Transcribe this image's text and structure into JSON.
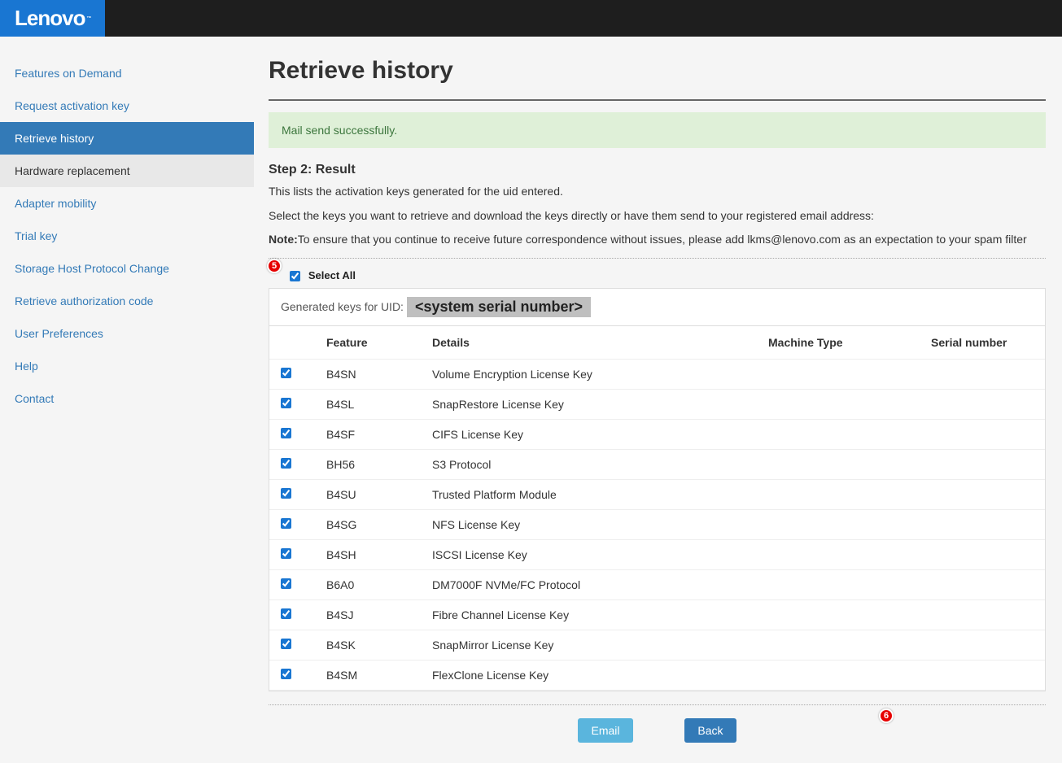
{
  "brand": "Lenovo",
  "sidebar": {
    "items": [
      {
        "label": "Features on Demand",
        "state": ""
      },
      {
        "label": "Request activation key",
        "state": ""
      },
      {
        "label": "Retrieve history",
        "state": "active"
      },
      {
        "label": "Hardware replacement",
        "state": "highlighted"
      },
      {
        "label": "Adapter mobility",
        "state": ""
      },
      {
        "label": "Trial key",
        "state": ""
      },
      {
        "label": "Storage Host Protocol Change",
        "state": ""
      },
      {
        "label": "Retrieve authorization code",
        "state": ""
      },
      {
        "label": "User Preferences",
        "state": ""
      },
      {
        "label": "Help",
        "state": ""
      },
      {
        "label": "Contact",
        "state": ""
      }
    ]
  },
  "page": {
    "title": "Retrieve history",
    "alert": "Mail send successfully.",
    "step_heading": "Step 2: Result",
    "instruction1": "This lists the activation keys generated for the uid entered.",
    "instruction2": "Select the keys you want to retrieve and download the keys directly or have them send to your registered email address:",
    "note_label": "Note:",
    "note_text": "To ensure that you continue to receive future correspondence without issues, please add lkms@lenovo.com as an expectation to your spam filter",
    "select_all_label": "Select All",
    "generated_keys_prefix": "Generated keys for UID:",
    "uid_placeholder": "<system serial number>",
    "annotation5": "5",
    "annotation6": "6",
    "columns": {
      "feature": "Feature",
      "details": "Details",
      "machine_type": "Machine Type",
      "serial_number": "Serial number"
    },
    "rows": [
      {
        "feature": "B4SN",
        "details": "Volume Encryption License Key",
        "machine_type": "",
        "serial_number": ""
      },
      {
        "feature": "B4SL",
        "details": "SnapRestore License Key",
        "machine_type": "",
        "serial_number": ""
      },
      {
        "feature": "B4SF",
        "details": "CIFS License Key",
        "machine_type": "",
        "serial_number": ""
      },
      {
        "feature": "BH56",
        "details": "S3 Protocol",
        "machine_type": "",
        "serial_number": ""
      },
      {
        "feature": "B4SU",
        "details": "Trusted Platform Module",
        "machine_type": "",
        "serial_number": ""
      },
      {
        "feature": "B4SG",
        "details": "NFS License Key",
        "machine_type": "",
        "serial_number": ""
      },
      {
        "feature": "B4SH",
        "details": "ISCSI License Key",
        "machine_type": "",
        "serial_number": ""
      },
      {
        "feature": "B6A0",
        "details": "DM7000F NVMe/FC Protocol",
        "machine_type": "",
        "serial_number": ""
      },
      {
        "feature": "B4SJ",
        "details": "Fibre Channel License Key",
        "machine_type": "",
        "serial_number": ""
      },
      {
        "feature": "B4SK",
        "details": "SnapMirror License Key",
        "machine_type": "",
        "serial_number": ""
      },
      {
        "feature": "B4SM",
        "details": "FlexClone License Key",
        "machine_type": "",
        "serial_number": ""
      }
    ],
    "buttons": {
      "email": "Email",
      "back": "Back"
    }
  }
}
